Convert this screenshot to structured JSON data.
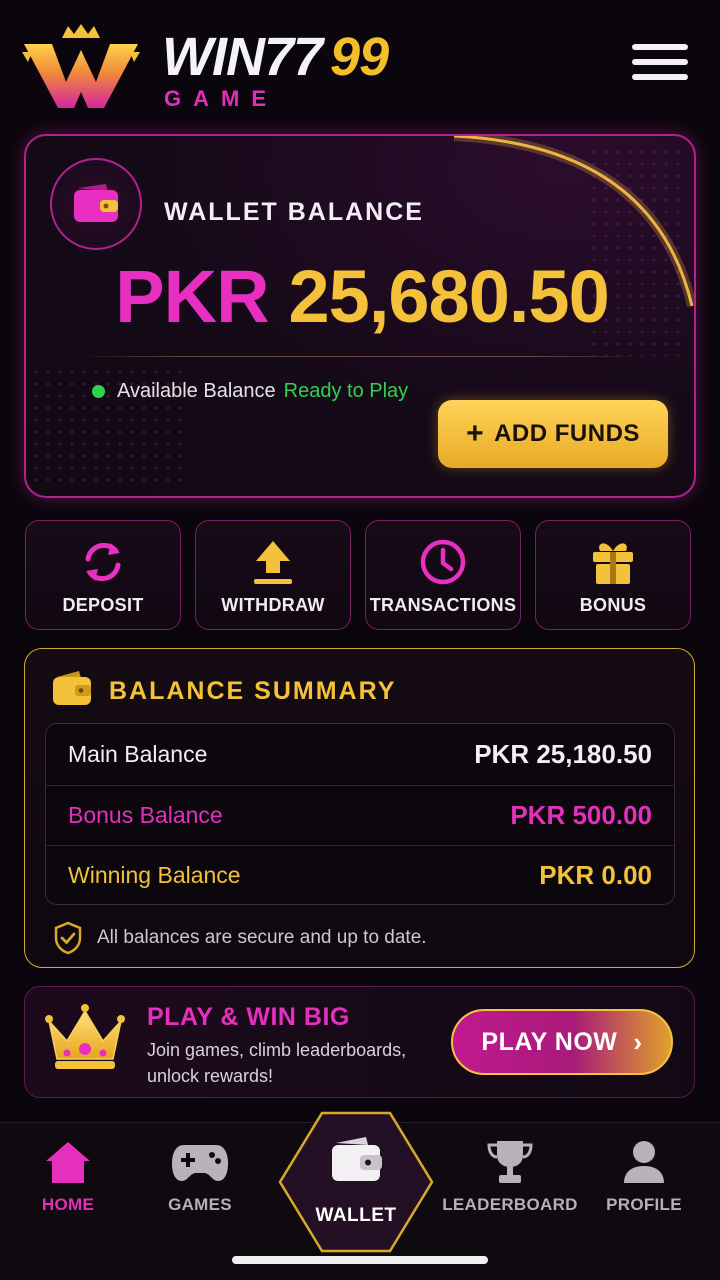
{
  "header": {
    "brand_main": "WIN77",
    "brand_accent": "99",
    "brand_sub": "GAME",
    "menu_icon": "hamburger-menu-icon"
  },
  "wallet": {
    "title": "WALLET BALANCE",
    "currency": "PKR",
    "amount": "25,680.50",
    "available_label": "Available Balance",
    "status": "Ready to Play",
    "add_funds_icon": "+",
    "add_funds_label": "ADD FUNDS"
  },
  "quick_actions": [
    {
      "label": "DEPOSIT",
      "icon": "refresh-icon"
    },
    {
      "label": "WITHDRAW",
      "icon": "upload-arrow-icon"
    },
    {
      "label": "TRANSACTIONS",
      "icon": "clock-icon"
    },
    {
      "label": "BONUS",
      "icon": "gift-icon"
    }
  ],
  "summary": {
    "title": "BALANCE SUMMARY",
    "rows": [
      {
        "label": "Main Balance",
        "value": "PKR 25,180.50",
        "color": "#f3eef3"
      },
      {
        "label": "Bonus Balance",
        "value": "PKR 500.00",
        "color": "#e52fbd"
      },
      {
        "label": "Winning Balance",
        "value": "PKR 0.00",
        "color": "#f3c13a"
      }
    ],
    "secure_note": "All balances are secure and up to date."
  },
  "promo": {
    "title": "PLAY & WIN BIG",
    "description": "Join games, climb leaderboards, unlock rewards!",
    "button_label": "PLAY NOW",
    "button_chevron": "›"
  },
  "bottom_nav": {
    "items": [
      {
        "label": "HOME",
        "icon": "home-icon",
        "active": true
      },
      {
        "label": "GAMES",
        "icon": "gamepad-icon",
        "active": false
      },
      {
        "label": "WALLET",
        "icon": "wallet-icon",
        "active": false
      },
      {
        "label": "LEADERBOARD",
        "icon": "trophy-icon",
        "active": false
      },
      {
        "label": "PROFILE",
        "icon": "user-icon",
        "active": false
      }
    ]
  },
  "colors": {
    "background": "#0b060d",
    "magenta": "#e52fbd",
    "gold": "#f3c13a",
    "green": "#35d04f"
  }
}
